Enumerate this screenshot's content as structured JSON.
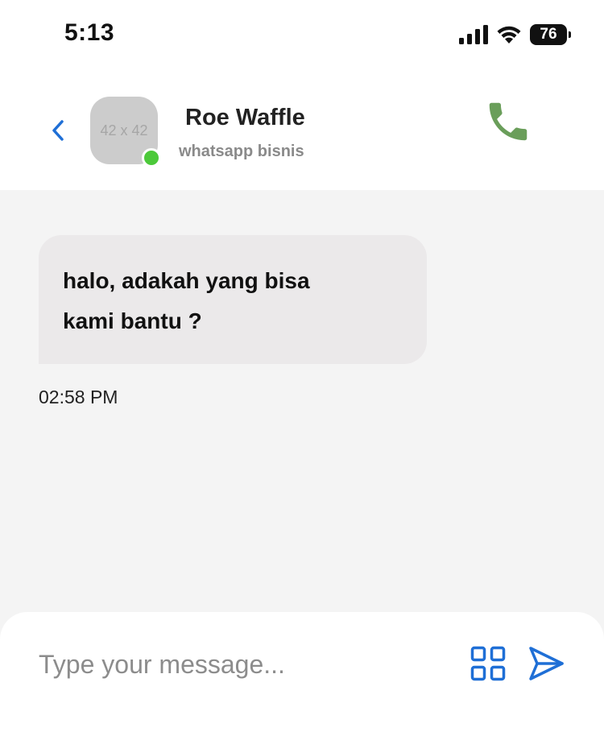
{
  "status_bar": {
    "time": "5:13",
    "battery_level": "76",
    "icons": [
      "signal-icon",
      "wifi-icon",
      "battery-icon"
    ]
  },
  "header": {
    "back_icon": "chevron-left-icon",
    "avatar_placeholder": "42 x 42",
    "contact_name": "Roe Waffle",
    "contact_subtitle": "whatsapp bisnis",
    "online": true,
    "call_icon": "phone-icon"
  },
  "messages": [
    {
      "text": "halo, adakah yang bisa kami bantu ?",
      "time": "02:58 PM",
      "direction": "incoming"
    }
  ],
  "composer": {
    "placeholder": "Type your message...",
    "value": "",
    "attach_icon": "grid-icon",
    "send_icon": "send-icon"
  },
  "colors": {
    "accent_blue": "#1f6fd6",
    "call_green": "#6a9e5a",
    "online_green": "#4cc93a",
    "bubble_bg": "#ebe9ea",
    "chat_bg": "#f4f4f4"
  }
}
